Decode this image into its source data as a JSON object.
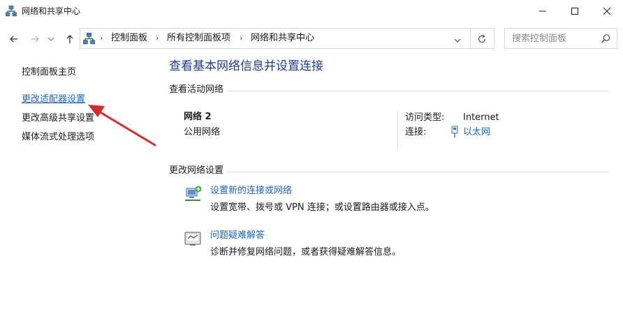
{
  "window": {
    "title": "网络和共享中心"
  },
  "navigation": {
    "breadcrumbs": [
      "控制面板",
      "所有控制面板项",
      "网络和共享中心"
    ],
    "search_placeholder": "搜索控制面板"
  },
  "sidebar": {
    "links": [
      {
        "label": "控制面板主页"
      },
      {
        "label": "更改适配器设置"
      },
      {
        "label": "更改高级共享设置"
      },
      {
        "label": "媒体流式处理选项"
      }
    ]
  },
  "main": {
    "title": "查看基本网络信息并设置连接",
    "active_networks": {
      "section_label": "查看活动网络",
      "network_name": "网络 2",
      "network_type": "公用网络",
      "access_type_label": "访问类型:",
      "access_type_value": "Internet",
      "connection_label": "连接:",
      "connection_value": "以太网"
    },
    "change_settings": {
      "section_label": "更改网络设置",
      "tasks": [
        {
          "link": "设置新的连接或网络",
          "description": "设置宽带、拨号或 VPN 连接；或设置路由器或接入点。",
          "icon": "new-connection-icon"
        },
        {
          "link": "问题疑难解答",
          "description": "诊断并修复网络问题，或者获得疑难解答信息。",
          "icon": "troubleshoot-icon"
        }
      ]
    }
  },
  "colors": {
    "link": "#1a64c8",
    "title": "#1e3d96",
    "annotation_arrow": "#d42a2a"
  }
}
